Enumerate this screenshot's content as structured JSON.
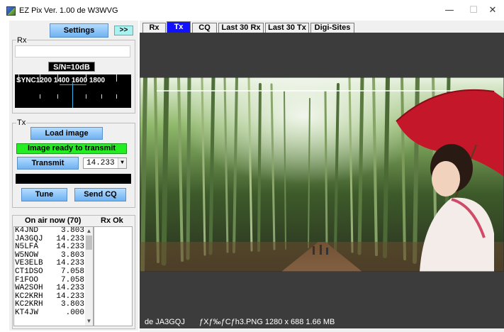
{
  "window": {
    "title": "EZ Pix",
    "version": "Ver. 1.00 de W3WVG",
    "minimize_icon": "—",
    "maximize_icon": "☐",
    "close_icon": "✕"
  },
  "left": {
    "settings_label": "Settings",
    "expand_label": ">>",
    "rx": {
      "label": "Rx",
      "sn_readout": "S/N=10dB",
      "waterfall_scale": "SYNC1200   1400   1600   1800"
    },
    "tx": {
      "label": "Tx",
      "load_image_label": "Load image",
      "status_text": "Image ready to transmit",
      "transmit_label": "Transmit",
      "frequency": "14.233",
      "tune_label": "Tune",
      "send_cq_label": "Send CQ"
    },
    "on_air": {
      "header": "On air now (70)",
      "rx_ok_header": "Rx Ok",
      "stations": [
        {
          "call": "K4JND",
          "freq": "3.803"
        },
        {
          "call": "JA3GQJ",
          "freq": "14.233"
        },
        {
          "call": "N5LFA",
          "freq": "14.233"
        },
        {
          "call": "W5NOW",
          "freq": "3.803"
        },
        {
          "call": "VE3ELB",
          "freq": "14.233"
        },
        {
          "call": "CT1DSO",
          "freq": "7.058"
        },
        {
          "call": "F1FOO",
          "freq": "7.058"
        },
        {
          "call": "WA2SOH",
          "freq": "14.233"
        },
        {
          "call": "KC2KRH",
          "freq": "14.233"
        },
        {
          "call": "KC2KRH",
          "freq": "3.803"
        },
        {
          "call": "KT4JW",
          "freq": ".000"
        }
      ]
    }
  },
  "tabs": [
    {
      "label": "Rx",
      "active": false
    },
    {
      "label": "Tx",
      "active": true
    },
    {
      "label": "CQ",
      "active": false
    },
    {
      "label": "Last 30 Rx",
      "active": false
    },
    {
      "label": "Last 30 Tx",
      "active": false
    },
    {
      "label": "Digi-Sites",
      "active": false
    }
  ],
  "status": {
    "callsign": "de JA3GQJ",
    "file_info": "ƒXƒ‰ƒCƒh3.PNG  1280 x 688  1.66 MB"
  },
  "colors": {
    "button_blue": "#6fb2f2",
    "active_tab": "#1212ff",
    "ready_green": "#22ee22",
    "dark_bg": "#3c3c3c"
  }
}
